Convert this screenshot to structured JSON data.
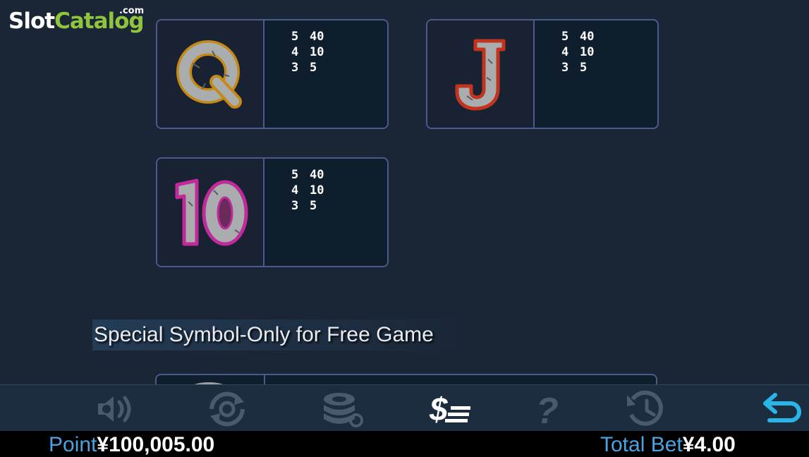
{
  "watermark": {
    "slot": "Slot",
    "catalog": "Catalog",
    "com": ".com"
  },
  "paytable": [
    {
      "symbol": "Q",
      "payouts": [
        {
          "count": "5",
          "pay": "40"
        },
        {
          "count": "4",
          "pay": "10"
        },
        {
          "count": "3",
          "pay": "5"
        }
      ]
    },
    {
      "symbol": "J",
      "payouts": [
        {
          "count": "5",
          "pay": "40"
        },
        {
          "count": "4",
          "pay": "10"
        },
        {
          "count": "3",
          "pay": "5"
        }
      ]
    },
    {
      "symbol": "10",
      "payouts": [
        {
          "count": "5",
          "pay": "40"
        },
        {
          "count": "4",
          "pay": "10"
        },
        {
          "count": "3",
          "pay": "5"
        }
      ]
    }
  ],
  "special_section": {
    "title": "Special Symbol-Only for Free Game"
  },
  "toolbar": {
    "buttons": [
      "sound-icon",
      "autoplay-icon",
      "bet-settings-icon",
      "paytable-icon",
      "help-icon",
      "history-icon",
      "back-icon"
    ],
    "active_color": "#ffffff",
    "inactive_color": "#4a5a6c",
    "accent_color": "#29b6e6"
  },
  "status": {
    "point_label": "Point",
    "point_value": "¥100,005.00",
    "total_bet_label": "Total Bet",
    "total_bet_value": "¥4.00"
  }
}
